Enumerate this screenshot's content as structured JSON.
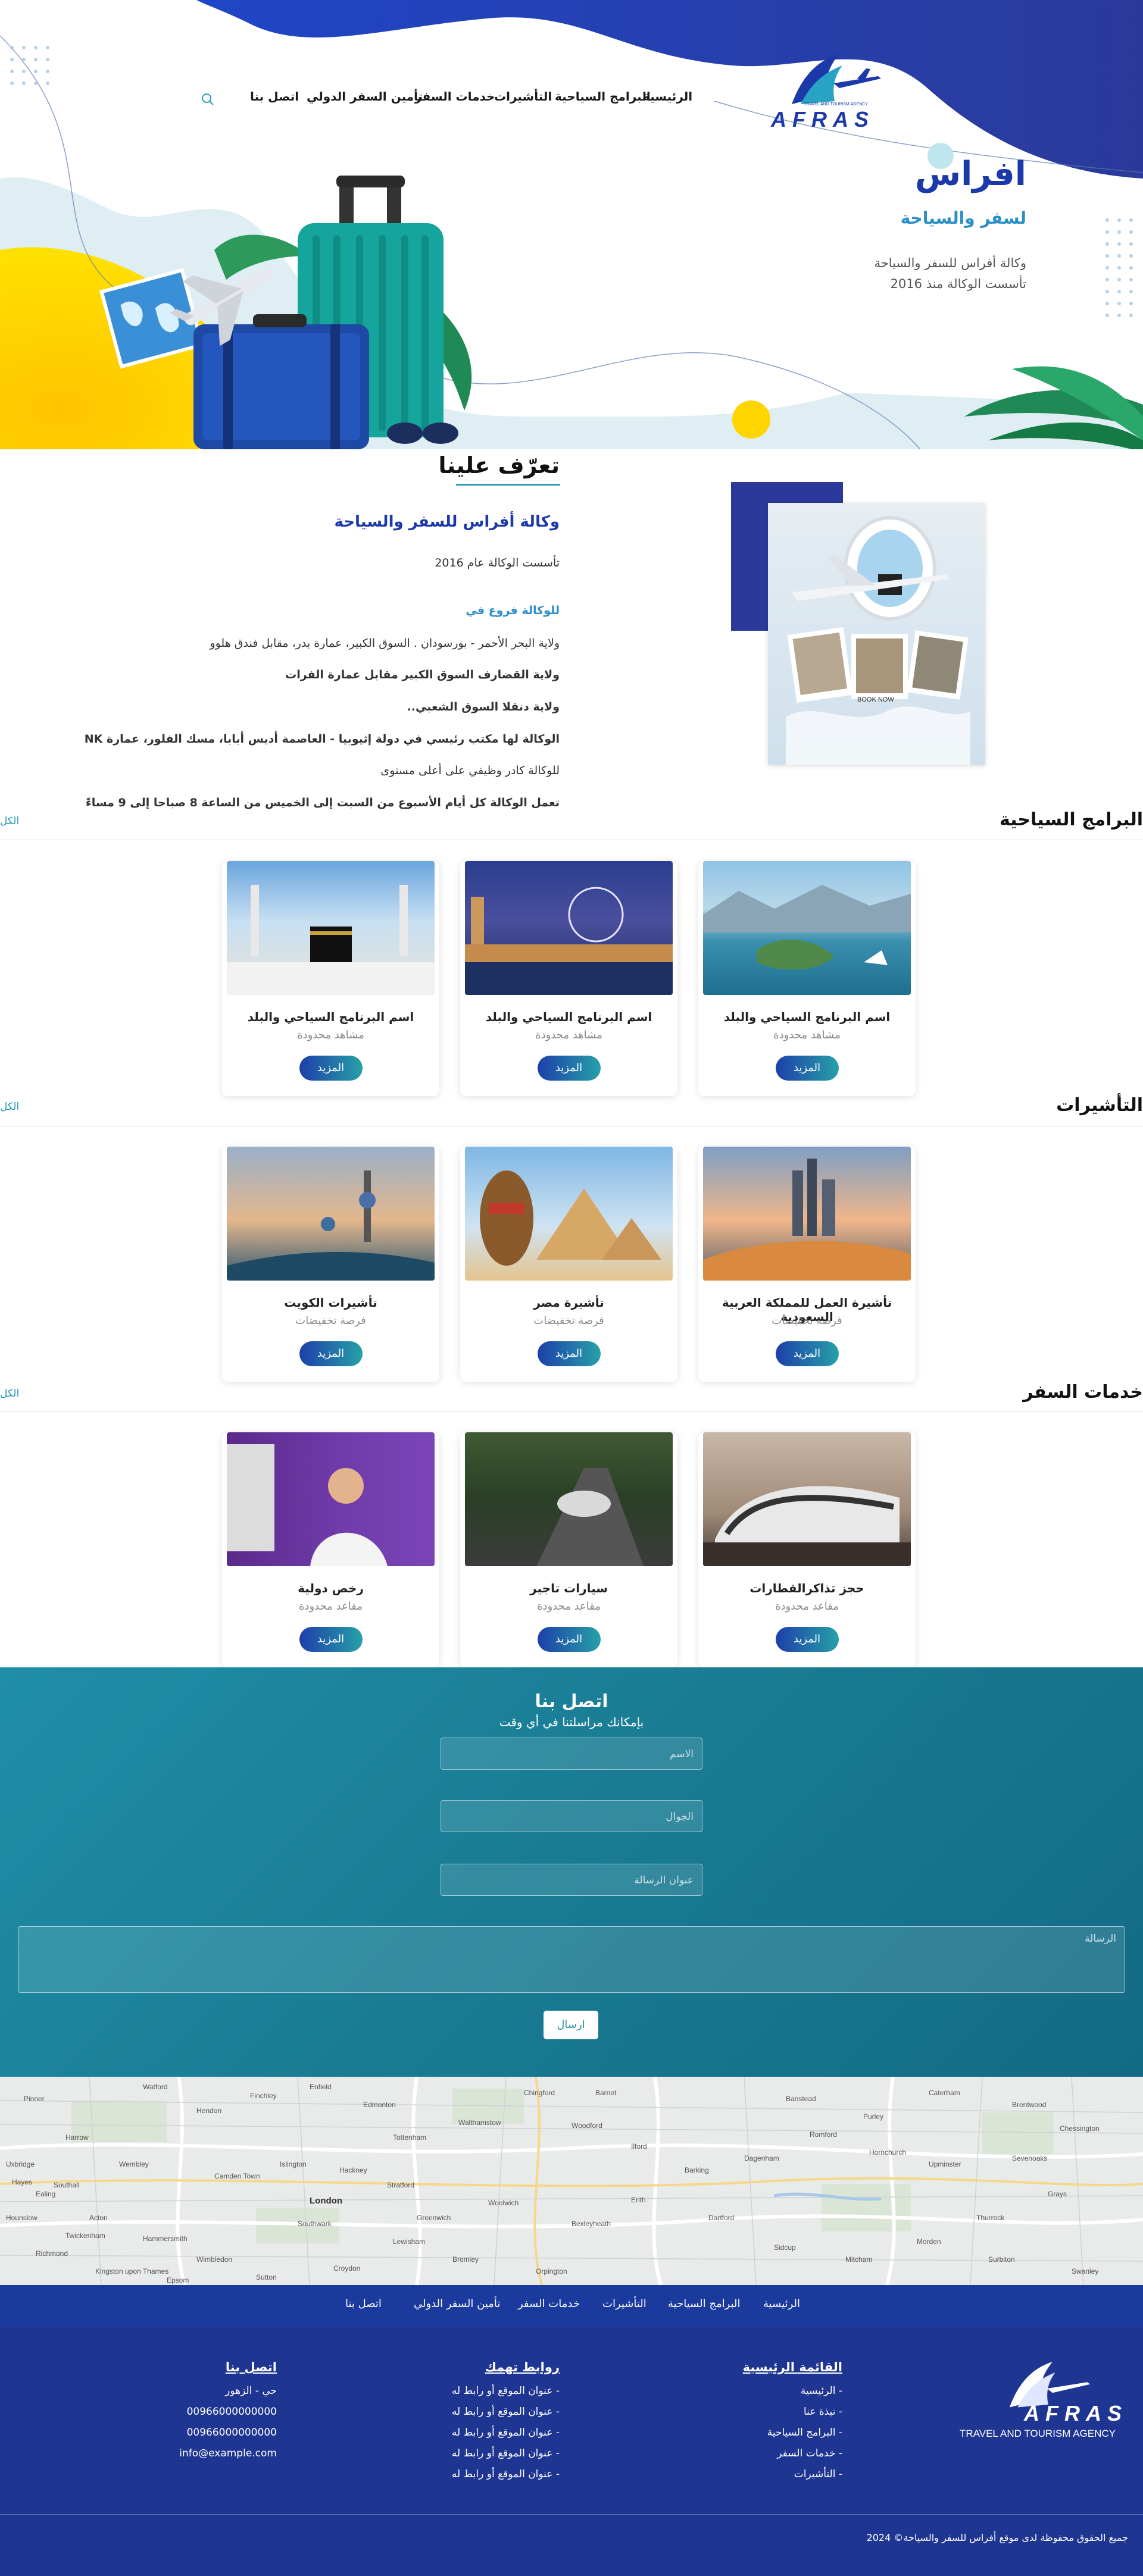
{
  "brand": {
    "logo_text": "AFRAS",
    "logo_tagline": "TRAVEL AND TOURISM AGENCY"
  },
  "nav": {
    "items": [
      "الرئيسية",
      "البرامج السياحية",
      "التأشيرات",
      "خدمات السفر",
      "تأمين السفر الدولي",
      "اتصل بنا"
    ]
  },
  "hero": {
    "title": "افراس",
    "subtitle": "لسفر والسياحة",
    "line1": "وكالة أفراس للسفر والسياحة",
    "line2": "تأسست الوكالة منذ 2016"
  },
  "about": {
    "heading": "تعرّف علينا",
    "title": "وكالة أفراس للسفر والسياحة",
    "founded": "تأسست الوكالة عام 2016",
    "branches_heading": "للوكالة فروع في",
    "b1": "ولاية البحر الأحمر - بورسودان . السوق الكبير، عمارة بدر، مقابل فندق هلوو",
    "b2": "ولاية القضارف السوق الكبير مقابل عمارة الفرات",
    "b3": "ولاية دنقلا السوق الشعبي..",
    "b4": "الوكالة لها مكتب رئيسي في دولة إثيوبيا - العاصمة أديس أبابا، مسك الفلور، عمارة NK",
    "b5": "للوكالة كادر وظيفي على أعلى مستوى",
    "b6": "تعمل الوكالة كل أيام الأسبوع من السبت إلى الخميس من الساعة 8 صباحا إلى 9 مساءً",
    "book_now": "BOOK NOW"
  },
  "programs": {
    "heading": "البرامج السياحية",
    "view_all": "الكل",
    "cards": [
      {
        "title": "اسم البرنامج السياحي والبلد",
        "subtitle": "مشاهد محدودة",
        "button": "المزيد"
      },
      {
        "title": "اسم البرنامج السياحي والبلد",
        "subtitle": "مشاهد محدودة",
        "button": "المزيد"
      },
      {
        "title": "اسم البرنامج السياحي والبلد",
        "subtitle": "مشاهد محدودة",
        "button": "المزيد"
      }
    ]
  },
  "visas": {
    "heading": "التأشيرات",
    "view_all": "الكل",
    "cards": [
      {
        "title": "تأشيرة العمل للمملكة العربية السعودية",
        "subtitle": "فرصة تخفيضات",
        "button": "المزيد"
      },
      {
        "title": "تأشيرة مصر",
        "subtitle": "فرصة تخفيضات",
        "button": "المزيد"
      },
      {
        "title": "تأشيرات الكويت",
        "subtitle": "فرصة تخفيضات",
        "button": "المزيد"
      }
    ]
  },
  "services": {
    "heading": "خدمات السفر",
    "view_all": "الكل",
    "cards": [
      {
        "title": "حجز تذاكرالقطارات",
        "subtitle": "مقاعد محدودة",
        "button": "المزيد"
      },
      {
        "title": "سيارات تاجير",
        "subtitle": "مقاعد محدودة",
        "button": "المزيد"
      },
      {
        "title": "رخص دولية",
        "subtitle": "مقاعد محدودة",
        "button": "المزيد"
      }
    ]
  },
  "contact": {
    "heading": "اتصل بنا",
    "subheading": "بإمكانك مراسلتنا في أي وقت",
    "name_placeholder": "الاسم",
    "phone_placeholder": "الجوال",
    "subject_placeholder": "عنوان الرسالة",
    "message_placeholder": "الرسالة",
    "submit": "ارسال"
  },
  "map": {
    "labels": [
      "Pinner",
      "Harrow",
      "Wembley",
      "Hendon",
      "Finchley",
      "Enfield",
      "Edmonton",
      "Tottenham",
      "Walthamstow",
      "Chingford",
      "Woodford",
      "Ilford",
      "Barking",
      "Dagenham",
      "Romford",
      "Hornchurch",
      "Upminster",
      "Ealing",
      "Acton",
      "Hammersmith",
      "Camden Town",
      "Islington",
      "Hackney",
      "Stratford",
      "London",
      "Southwark",
      "Greenwich",
      "Lewisham",
      "Woolwich",
      "Bexleyheath",
      "Erith",
      "Dartford",
      "Richmond",
      "Kingston upon Thames",
      "Wimbledon",
      "Croydon",
      "Bromley",
      "Sutton",
      "Epsom",
      "Orpington",
      "Hounslow",
      "Twickenham",
      "Uxbridge",
      "Hayes",
      "Southall",
      "Watford",
      "Barnet",
      "Brentwood",
      "Grays",
      "Thurrock",
      "Sidcup",
      "Mitcham",
      "Morden",
      "Surbiton",
      "Chessington",
      "Banstead",
      "Purley",
      "Caterham",
      "Swanley",
      "Sevenoaks"
    ]
  },
  "footer_nav": {
    "items": [
      "الرئيسية",
      "البرامج السياحية",
      "التأشيرات",
      "خدمات السفر",
      "تأمين السفر الدولي",
      "اتصل بنا"
    ]
  },
  "footer": {
    "tagline": "TRAVEL AND TOURISM AGENCY",
    "main_menu_heading": "القائمة الرئيسية",
    "main_menu": [
      "- الرئيسية",
      "- نبذة عنا",
      "- البرامج السياحية",
      "- خدمات السفر",
      "- التأشيرات"
    ],
    "links_heading": "روابط تهمك",
    "links": [
      "- عنوان الموقع أو رابط له",
      "- عنوان الموقع أو رابط له",
      "- عنوان الموقع أو رابط له",
      "- عنوان الموقع أو رابط له",
      "- عنوان الموقع أو رابط له"
    ],
    "contact_heading": "اتصل بنا",
    "address": "حي - الزهور",
    "phone1": "00966000000000",
    "phone2": "00966000000000",
    "email": "info@example.com",
    "copyright": "جميع الحقوق محفوظة لدى موقع أفراس للسفر والسياحة© 2024"
  },
  "colors": {
    "primary": "#1f3592",
    "accent": "#2a9bb4",
    "yellow": "#ffd500"
  }
}
